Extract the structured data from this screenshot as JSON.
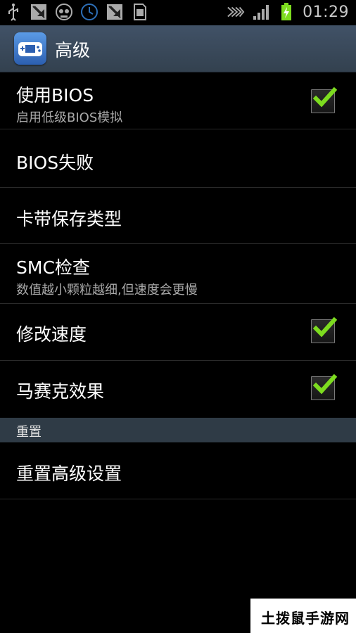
{
  "status_bar": {
    "time": "01:29",
    "icons_left": [
      "usb-icon",
      "debug-icon",
      "robot-icon",
      "clock-icon",
      "debug-icon",
      "sd-card-icon"
    ],
    "icons_right": [
      "nfc-icon",
      "signal-icon",
      "battery-charging-icon"
    ],
    "accent_battery": "#7ddc1f"
  },
  "action_bar": {
    "title": "高级"
  },
  "preferences": [
    {
      "title": "使用BIOS",
      "summary": "启用低级BIOS模拟",
      "checked": true
    },
    {
      "title": "BIOS失败"
    },
    {
      "title": "卡带保存类型"
    },
    {
      "title": "SMC检查",
      "summary": "数值越小颗粒越细,但速度会更慢"
    },
    {
      "title": "修改速度",
      "checked": true
    },
    {
      "title": "马赛克效果",
      "checked": true
    }
  ],
  "section": {
    "label": "重置"
  },
  "reset_item": {
    "title": "重置高级设置"
  },
  "watermark": {
    "text": "土拨鼠手游网"
  },
  "colors": {
    "check": "#7ddc1f",
    "actionbar": "#3b4a5a",
    "section": "#2f3b46"
  }
}
